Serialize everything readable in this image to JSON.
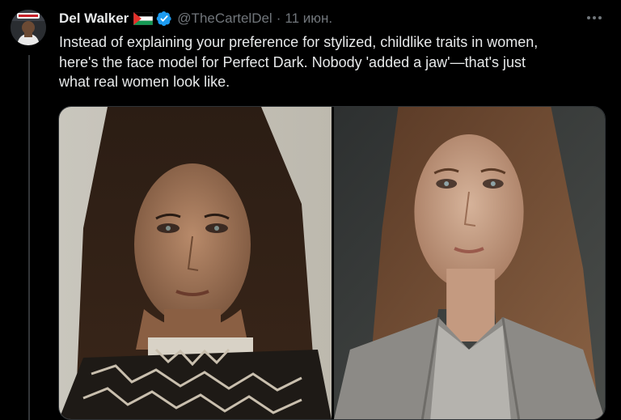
{
  "tweet": {
    "display_name": "Del Walker",
    "handle": "@TheCartelDel",
    "separator": "·",
    "timestamp": "11 июн.",
    "text_lines": [
      "Instead of explaining your preference for stylized, childlike traits in women,",
      "here's the face model for Perfect Dark. Nobody 'added a jaw'—that's just",
      "what real women look like."
    ],
    "icons": {
      "flag": "palestine-flag-icon",
      "verified": "verified-badge-icon",
      "more": "more-options-icon",
      "avatar": "profile-avatar"
    },
    "colors": {
      "background": "#000000",
      "primary_text": "#e7e9ea",
      "secondary_text": "#71767b",
      "verified_blue": "#1d9bf0",
      "border": "#2f3336"
    },
    "media": [
      {
        "name": "photo-left",
        "kind": "portrait photo"
      },
      {
        "name": "photo-right",
        "kind": "portrait photo"
      }
    ]
  }
}
